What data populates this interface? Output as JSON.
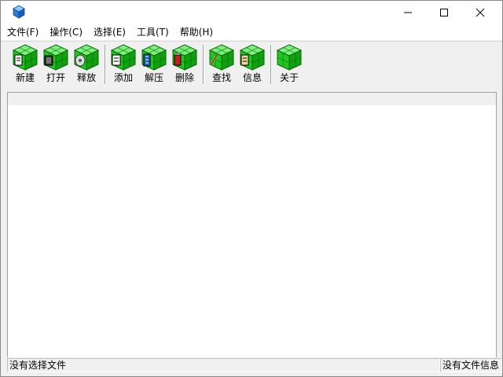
{
  "window": {
    "icon": "app-cube-icon",
    "controls": {
      "minimize": "minimize-icon",
      "maximize": "maximize-icon",
      "close": "close-icon"
    }
  },
  "menu": [
    {
      "label": "文件(F)"
    },
    {
      "label": "操作(C)"
    },
    {
      "label": "选择(E)"
    },
    {
      "label": "工具(T)"
    },
    {
      "label": "帮助(H)"
    }
  ],
  "toolbar": {
    "cube_color": "#1ec81e",
    "buttons": [
      {
        "label": "新建",
        "icon": "new-document-icon"
      },
      {
        "label": "打开",
        "icon": "open-folder-icon"
      },
      {
        "label": "释放",
        "icon": "release-icon"
      },
      {
        "label": "添加",
        "icon": "add-file-icon"
      },
      {
        "label": "解压",
        "icon": "extract-icon"
      },
      {
        "label": "删除",
        "icon": "delete-icon"
      },
      {
        "label": "查找",
        "icon": "find-icon"
      },
      {
        "label": "信息",
        "icon": "info-icon"
      },
      {
        "label": "关于",
        "icon": "about-icon"
      }
    ]
  },
  "status": {
    "left": "没有选择文件",
    "right": "没有文件信息"
  }
}
